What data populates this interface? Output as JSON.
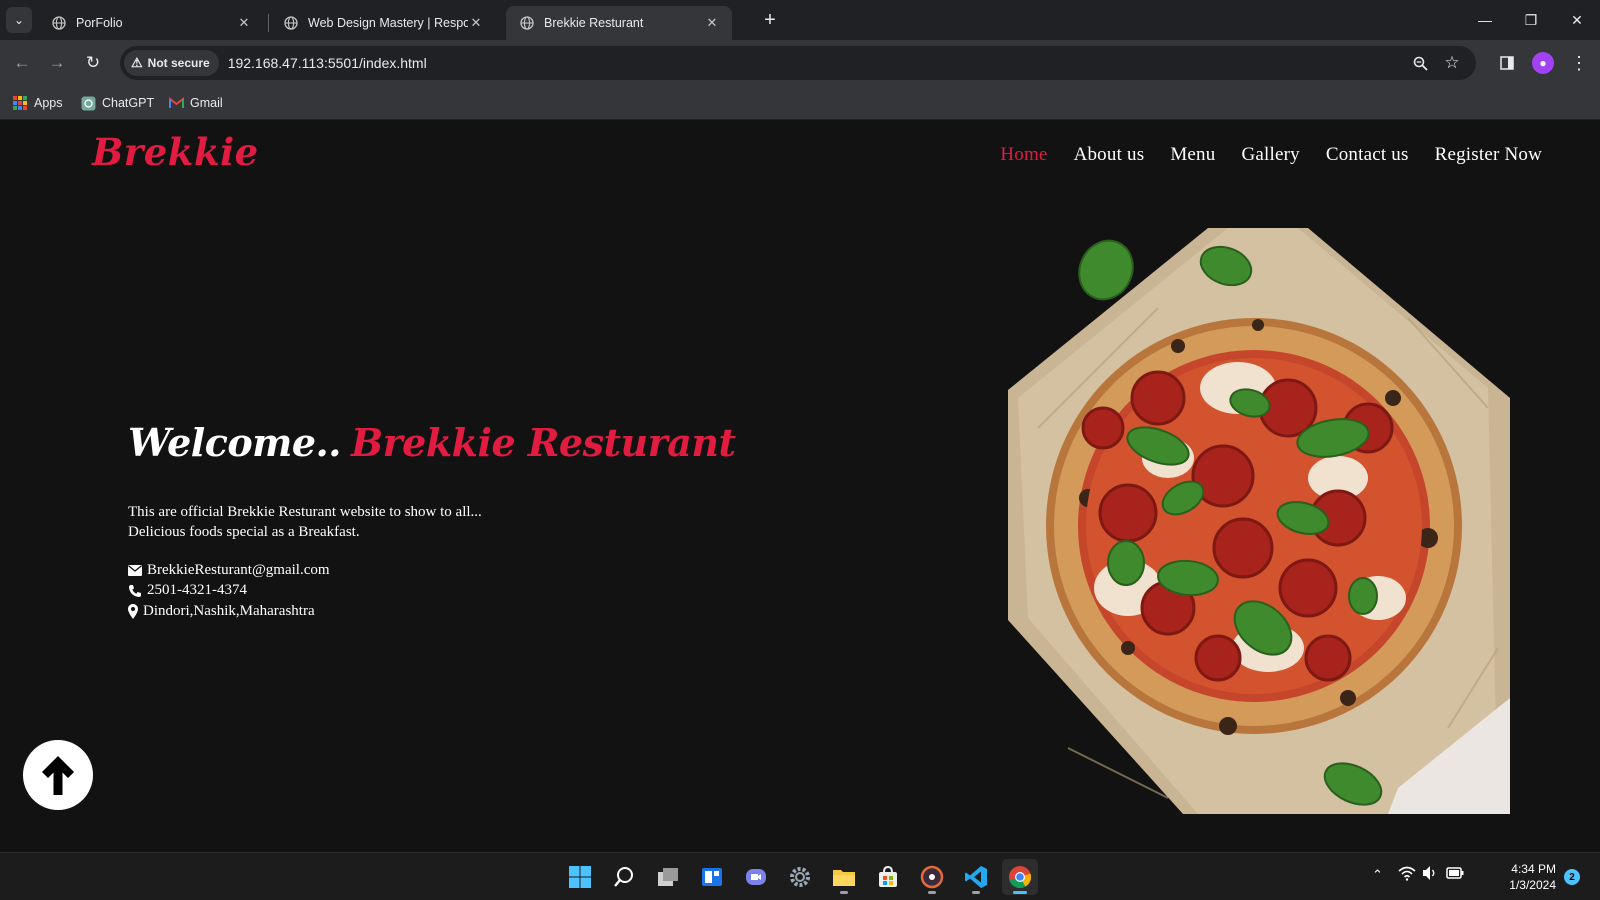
{
  "browser": {
    "tabs": [
      {
        "title": "PorFolio"
      },
      {
        "title": "Web Design Mastery | Responsi"
      },
      {
        "title": "Brekkie Resturant"
      }
    ],
    "address": {
      "security_label": "Not secure",
      "url": "192.168.47.113:5501/index.html"
    },
    "bookmarks": [
      {
        "label": "Apps"
      },
      {
        "label": "ChatGPT"
      },
      {
        "label": "Gmail"
      }
    ]
  },
  "site": {
    "logo": "Brekkie",
    "nav": [
      {
        "label": "Home",
        "active": true
      },
      {
        "label": "About us",
        "active": false
      },
      {
        "label": "Menu",
        "active": false
      },
      {
        "label": "Gallery",
        "active": false
      },
      {
        "label": "Contact us",
        "active": false
      },
      {
        "label": "Register Now",
        "active": false
      }
    ],
    "hero": {
      "welcome": "Welcome..",
      "brand": "Brekkie Resturant",
      "description_line1": "This are official Brekkie Resturant website to show to all...",
      "description_line2": "Delicious foods special as a Breakfast.",
      "email": "BrekkieResturant@gmail.com",
      "phone": "2501-4321-4374",
      "address": "Dindori,Nashik,Maharashtra"
    },
    "accent_color": "#e21b41"
  },
  "taskbar": {
    "clock_time": "4:34 PM",
    "clock_date": "1/3/2024",
    "notification_count": "2"
  }
}
